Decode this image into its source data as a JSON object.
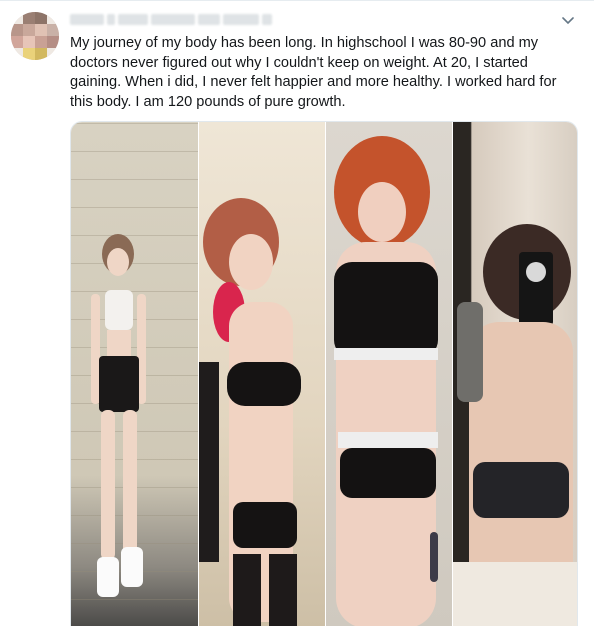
{
  "tweet": {
    "text": "My journey of my body has been long. In highschool I was 80-90 and my doctors never figured out why I couldn't keep on weight. At 20, I started gaining. When i did, I never felt happier and more healthy. I worked hard for this body. I am 120 pounds of pure growth.",
    "menu_icon": "chevron-down-icon",
    "author_avatar": "avatar",
    "media": {
      "panels": [
        {
          "name": "photo-1",
          "description_icon": "person-photo"
        },
        {
          "name": "photo-2",
          "description_icon": "person-photo"
        },
        {
          "name": "photo-3",
          "description_icon": "person-photo"
        },
        {
          "name": "photo-4",
          "description_icon": "person-photo"
        }
      ]
    }
  },
  "colors": {
    "text": "#14171a",
    "border": "#e6ecf0",
    "icon": "#657786"
  }
}
